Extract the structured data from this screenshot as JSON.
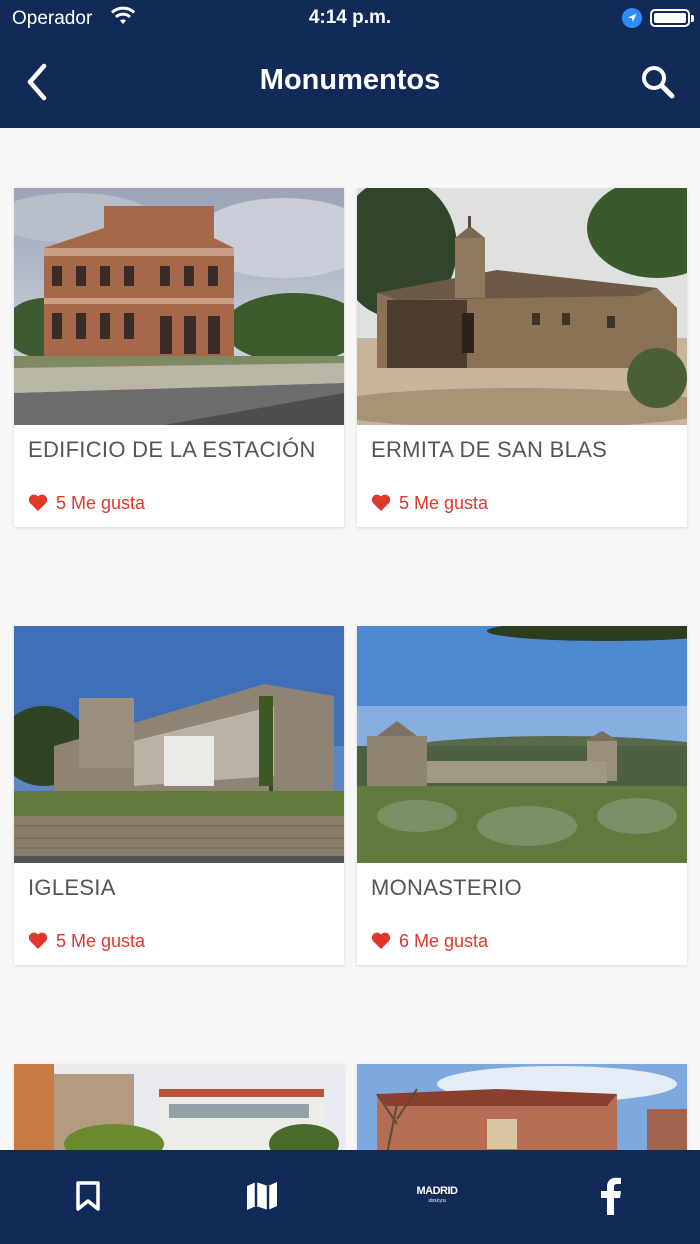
{
  "status_bar": {
    "carrier": "Operador",
    "time": "4:14 p.m."
  },
  "header": {
    "title": "Monumentos"
  },
  "cards": [
    {
      "name": "EDIFICIO DE LA ESTACIÓN",
      "likes": "5 Me gusta"
    },
    {
      "name": "ERMITA DE SAN BLAS",
      "likes": "5 Me gusta"
    },
    {
      "name": "IGLESIA",
      "likes": "5 Me gusta"
    },
    {
      "name": "MONASTERIO",
      "likes": "6 Me gusta"
    }
  ],
  "tabbar": {
    "items": [
      {
        "icon": "bookmark-icon"
      },
      {
        "icon": "map-icon"
      },
      {
        "icon": "madrid-logo",
        "label": "MADRID",
        "sublabel": "about you"
      },
      {
        "icon": "facebook-icon"
      }
    ]
  },
  "colors": {
    "header": "#112a57",
    "like": "#e0362b",
    "background": "#f7f7f8"
  }
}
